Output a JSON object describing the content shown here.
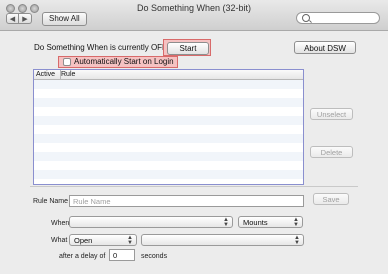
{
  "window": {
    "title": "Do Something When (32-bit)"
  },
  "toolbar": {
    "show_all": "Show All",
    "search": {
      "placeholder": ""
    }
  },
  "status": {
    "text": "Do Something When is currently OFF",
    "start_label": "Start"
  },
  "about_label": "About DSW",
  "autostart": {
    "label": "Automatically Start on Login",
    "checked": false
  },
  "table": {
    "headers": [
      "Active",
      "Rule"
    ],
    "rows": []
  },
  "actions": {
    "unselect": "Unselect",
    "delete": "Delete"
  },
  "form": {
    "rule_name_label": "Rule Name",
    "rule_name_placeholder": "Rule Name",
    "save_label": "Save",
    "when_label": "When",
    "when_value": "",
    "mounts_value": "Mounts",
    "what_label": "What",
    "what_value": "Open",
    "what_target": "",
    "delay_prefix": "after a delay of",
    "delay_value": "0",
    "delay_suffix": "seconds"
  },
  "colors": {
    "highlight_fill": "#f5c2c2",
    "highlight_border": "#d86a6a",
    "table_border": "#8a8fcf"
  }
}
